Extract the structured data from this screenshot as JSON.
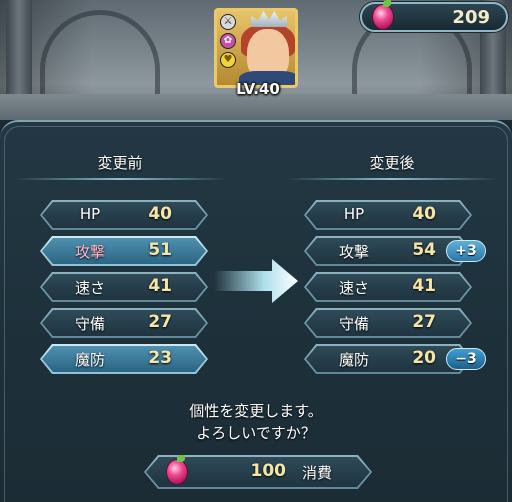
{
  "currency": {
    "icon": "orb-icon",
    "amount": "209"
  },
  "hero": {
    "level": "LV.40",
    "skill_icons": [
      "weapon-skill-icon",
      "assist-skill-icon",
      "passive-skill-icon"
    ]
  },
  "columns": {
    "before_title": "変更前",
    "after_title": "変更後"
  },
  "before_stats": [
    {
      "label": "HP",
      "value": "40"
    },
    {
      "label": "攻撃",
      "value": "51"
    },
    {
      "label": "速さ",
      "value": "41"
    },
    {
      "label": "守備",
      "value": "27"
    },
    {
      "label": "魔防",
      "value": "23"
    }
  ],
  "after_stats": [
    {
      "label": "HP",
      "value": "40"
    },
    {
      "label": "攻撃",
      "value": "54",
      "diff": "+3"
    },
    {
      "label": "速さ",
      "value": "41"
    },
    {
      "label": "守備",
      "value": "27"
    },
    {
      "label": "魔防",
      "value": "20",
      "diff": "−3"
    }
  ],
  "confirm": {
    "line1": "個性を変更します。",
    "line2": "よろしいですか？"
  },
  "cost": {
    "icon": "orb-icon",
    "amount": "100",
    "label": "消費"
  },
  "colors": {
    "value": "#f5e6a8",
    "asset": "#ffb6c6",
    "frame": "#8fb3c0"
  }
}
